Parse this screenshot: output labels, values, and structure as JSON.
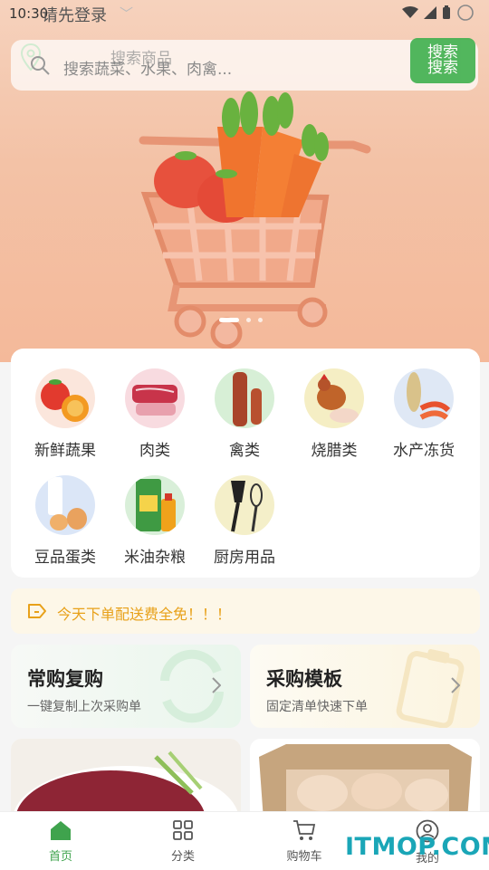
{
  "status_bar": {
    "time": "10:30"
  },
  "header": {
    "login_text": "请先登录"
  },
  "search": {
    "placeholder": "搜索蔬菜、水果、肉禽...",
    "ghost_placeholder": "搜索商品",
    "button_label": "搜索",
    "button_ghost_label": "搜索"
  },
  "banner": {
    "slide_count": 3,
    "active_slide": 1
  },
  "categories": [
    {
      "label": "新鲜蔬果",
      "icon": "vegetables-fruit-icon"
    },
    {
      "label": "肉类",
      "icon": "meat-icon"
    },
    {
      "label": "禽类",
      "icon": "poultry-icon"
    },
    {
      "label": "烧腊类",
      "icon": "roast-chicken-icon"
    },
    {
      "label": "水产冻货",
      "icon": "seafood-icon"
    },
    {
      "label": "豆品蛋类",
      "icon": "milk-eggs-icon"
    },
    {
      "label": "米油杂粮",
      "icon": "rice-oil-icon"
    },
    {
      "label": "厨房用品",
      "icon": "kitchen-utensils-icon"
    }
  ],
  "notice": {
    "text": "今天下单配送费全免！！！"
  },
  "quick_actions": [
    {
      "title": "常购复购",
      "subtitle": "一键复制上次采购单"
    },
    {
      "title": "采购模板",
      "subtitle": "固定清单快速下单"
    }
  ],
  "tabbar": [
    {
      "label": "首页",
      "icon": "home-icon",
      "active": true
    },
    {
      "label": "分类",
      "icon": "grid-icon",
      "active": false
    },
    {
      "label": "购物车",
      "icon": "cart-icon",
      "active": false
    },
    {
      "label": "我的",
      "icon": "user-icon",
      "active": false
    }
  ],
  "watermark": {
    "text": "ITMOP.COM"
  },
  "colors": {
    "accent": "#3fb04e",
    "notice_text": "#e8a11a",
    "watermark": "#1aa6b7"
  }
}
